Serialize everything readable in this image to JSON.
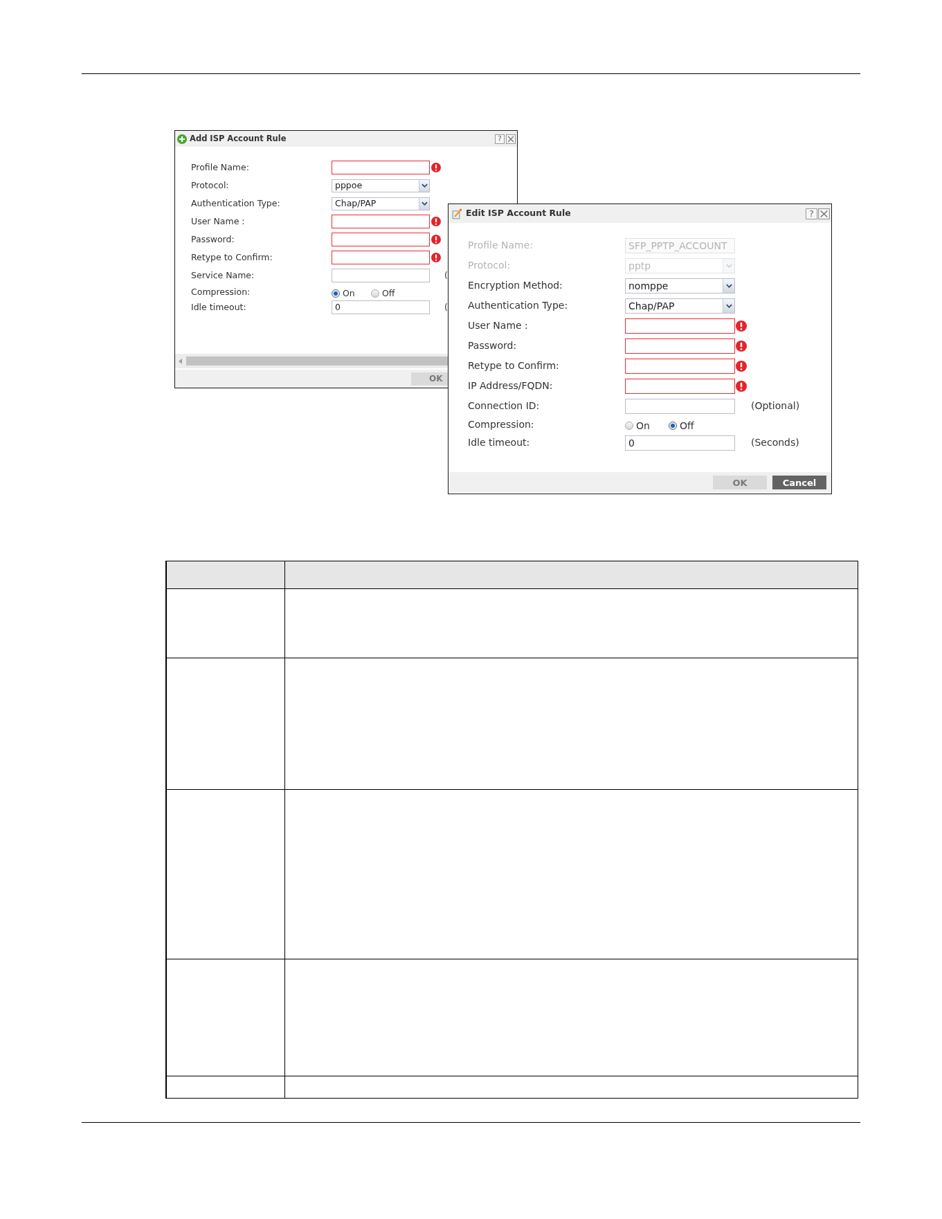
{
  "add_dialog": {
    "title": "Add ISP Account Rule",
    "help": "?",
    "fields": [
      {
        "kind": "text",
        "label": "Profile Name:",
        "error": true
      },
      {
        "kind": "select",
        "label": "Protocol:",
        "value": "pppoe"
      },
      {
        "kind": "select",
        "label": "Authentication Type:",
        "value": "Chap/PAP"
      },
      {
        "kind": "text",
        "label": "User Name :",
        "error": true
      },
      {
        "kind": "text",
        "label": "Password:",
        "error": true
      },
      {
        "kind": "text",
        "label": "Retype to Confirm:",
        "error": true
      },
      {
        "kind": "text",
        "label": "Service Name:",
        "error": false,
        "suffix": "("
      },
      {
        "kind": "radio",
        "label": "Compression:",
        "options": [
          {
            "label": "On",
            "selected": true
          },
          {
            "label": "Off",
            "selected": false
          }
        ]
      },
      {
        "kind": "text",
        "label": "Idle timeout:",
        "error": false,
        "value": "0",
        "suffix": "("
      }
    ],
    "buttons": [
      {
        "label": "OK",
        "disabled": true
      }
    ]
  },
  "edit_dialog": {
    "title": "Edit ISP Account Rule",
    "help": "?",
    "fields": [
      {
        "kind": "text",
        "label": "Profile Name:",
        "disabled": true,
        "error": false,
        "value": "SFP_PPTP_ACCOUNT"
      },
      {
        "kind": "select",
        "label": "Protocol:",
        "disabled": true,
        "value": "pptp"
      },
      {
        "kind": "select",
        "label": "Encryption Method:",
        "disabled": false,
        "value": "nomppe"
      },
      {
        "kind": "select",
        "label": "Authentication Type:",
        "disabled": false,
        "value": "Chap/PAP"
      },
      {
        "kind": "text",
        "label": "User Name :",
        "disabled": false,
        "error": true
      },
      {
        "kind": "text",
        "label": "Password:",
        "disabled": false,
        "error": true
      },
      {
        "kind": "text",
        "label": "Retype to Confirm:",
        "disabled": false,
        "error": true
      },
      {
        "kind": "text",
        "label": "IP Address/FQDN:",
        "disabled": false,
        "error": true
      },
      {
        "kind": "text",
        "label": "Connection ID:",
        "disabled": false,
        "error": false,
        "suffix": "(Optional)"
      },
      {
        "kind": "radio",
        "label": "Compression:",
        "disabled": false,
        "options": [
          {
            "label": "On",
            "selected": false
          },
          {
            "label": "Off",
            "selected": true
          }
        ]
      },
      {
        "kind": "text",
        "label": "Idle timeout:",
        "disabled": false,
        "error": false,
        "value": "0",
        "suffix": "(Seconds)"
      }
    ],
    "buttons": [
      {
        "label": "OK",
        "disabled": true
      },
      {
        "label": "Cancel",
        "disabled": false
      }
    ]
  },
  "table": {
    "rows": [
      {
        "kind": "header"
      },
      {
        "kind": "body"
      },
      {
        "kind": "body"
      },
      {
        "kind": "body"
      },
      {
        "kind": "body"
      },
      {
        "kind": "body"
      }
    ]
  }
}
